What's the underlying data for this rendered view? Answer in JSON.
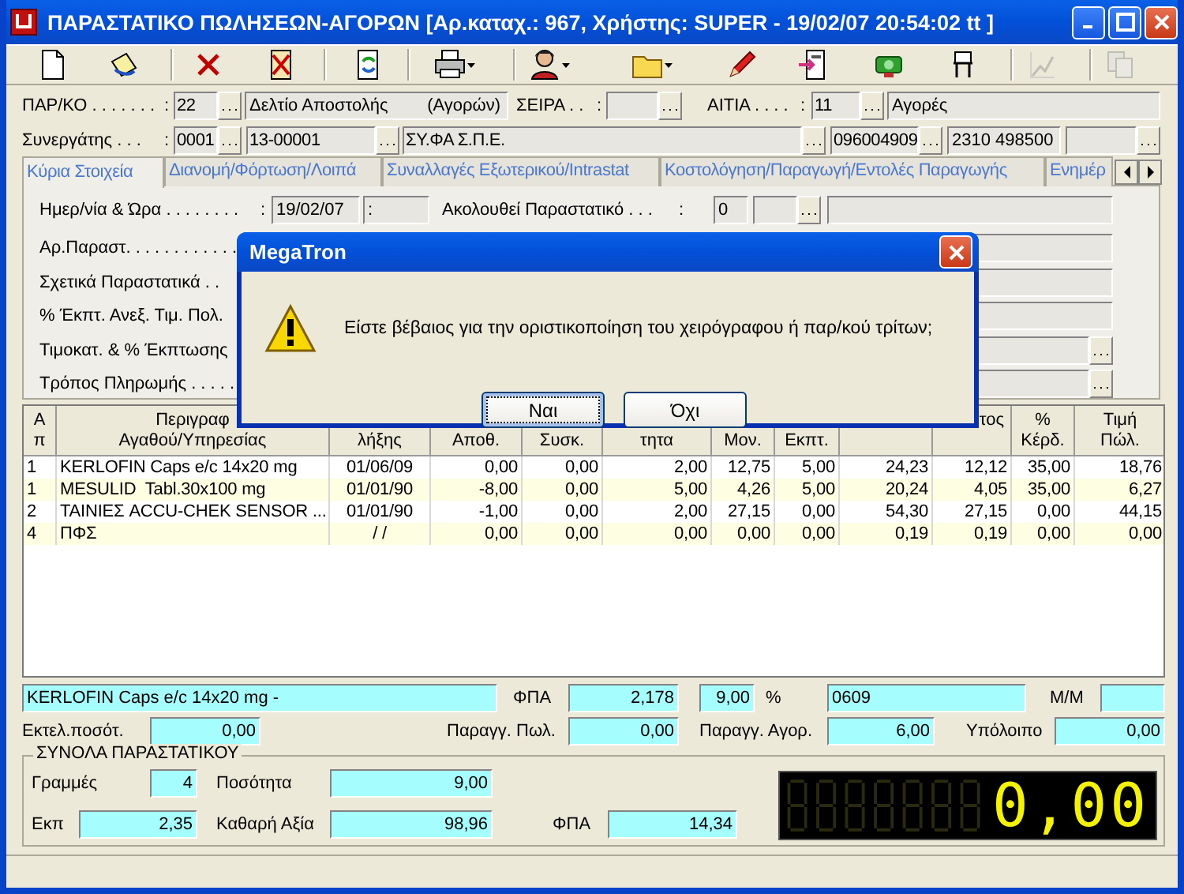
{
  "window": {
    "title": "ΠΑΡΑΣΤΑΤΙΚΟ ΠΩΛΗΣΕΩΝ-ΑΓΟΡΩΝ [Αρ.καταχ.: 967, Χρήστης: SUPER - 19/02/07 20:54:02 tt ]"
  },
  "toolbar": [
    {
      "kind": "new",
      "dropdown": false,
      "disabled": false
    },
    {
      "kind": "bucket",
      "dropdown": false,
      "disabled": false
    },
    {
      "kind": "delete",
      "dropdown": false,
      "disabled": false
    },
    {
      "kind": "cancel",
      "dropdown": false,
      "disabled": false
    },
    {
      "kind": "refresh",
      "dropdown": false,
      "disabled": false
    },
    {
      "kind": "print",
      "dropdown": true,
      "disabled": false
    },
    {
      "kind": "person",
      "dropdown": true,
      "disabled": false
    },
    {
      "kind": "folder",
      "dropdown": true,
      "disabled": false
    },
    {
      "kind": "pencil",
      "dropdown": false,
      "disabled": false
    },
    {
      "kind": "export",
      "dropdown": false,
      "disabled": false
    },
    {
      "kind": "cash",
      "dropdown": false,
      "disabled": false
    },
    {
      "kind": "chair",
      "dropdown": false,
      "disabled": false
    },
    {
      "kind": "chart",
      "dropdown": false,
      "disabled": true
    },
    {
      "kind": "copy",
      "dropdown": false,
      "disabled": true
    }
  ],
  "header_rows": [
    {
      "items": [
        {
          "kind": "label",
          "text": "ΠΑΡ/ΚΟ . . . . . . ."
        },
        {
          "kind": "colon",
          "text": ":"
        },
        {
          "kind": "lookup",
          "value": "22"
        },
        {
          "kind": "field",
          "value": "Δελτίο Αποστολής",
          "note": "(Αγορών)"
        },
        {
          "kind": "label",
          "text": "ΣΕΙΡΑ . ."
        },
        {
          "kind": "colon",
          "text": ":"
        },
        {
          "kind": "lookup"
        },
        {
          "kind": "label",
          "text": "ΑΙΤΙΑ . . . ."
        },
        {
          "kind": "colon",
          "text": ":"
        },
        {
          "kind": "lookup",
          "value": "11"
        },
        {
          "kind": "field",
          "value": "Αγορές"
        }
      ]
    },
    {
      "items": [
        {
          "kind": "label",
          "text": "Συνεργάτης . . ."
        },
        {
          "kind": "colon",
          "text": ":"
        },
        {
          "kind": "lookup",
          "value": "0001"
        },
        {
          "kind": "lookup",
          "value": "13-00001"
        },
        {
          "kind": "lookup",
          "value": "ΣΥ.ΦΑ Σ.Π.Ε."
        },
        {
          "kind": "lookup",
          "value": "096004909"
        },
        {
          "kind": "field",
          "value": "2310 498500"
        },
        {
          "kind": "lookup"
        }
      ]
    }
  ],
  "tabs": [
    {
      "label": "Κύρια Στοιχεία",
      "selected": true
    },
    {
      "label": "Διανομή/Φόρτωση/Λοιπά",
      "selected": false
    },
    {
      "label": "Συναλλαγές Εξωτερικού/Intrastat",
      "selected": false
    },
    {
      "label": "Κοστολόγηση/Παραγωγή/Εντολές Παραγωγής",
      "selected": false
    },
    {
      "label": "Ενημέρ",
      "selected": false
    }
  ],
  "main_tab": {
    "rows": [
      {
        "items": [
          {
            "kind": "label",
            "text": "Ημερ/νία & Ώρα . . . . . . . ."
          },
          {
            "kind": "colon",
            "text": ":"
          },
          {
            "kind": "field",
            "value": "19/02/07"
          },
          {
            "kind": "field",
            "value": ":"
          },
          {
            "kind": "label",
            "text": "Ακολουθεί Παραστατικό . . ."
          },
          {
            "kind": "colon",
            "text": ":"
          },
          {
            "kind": "field",
            "value": "0"
          },
          {
            "kind": "lookup"
          },
          {
            "kind": "field"
          }
        ]
      },
      {
        "items": [
          {
            "kind": "label",
            "text": "Αρ.Παραστ. . . . . . . . . . . ."
          },
          {
            "kind": "field"
          }
        ]
      },
      {
        "items": [
          {
            "kind": "label",
            "text": "Σχετικά Παραστατικά . ."
          },
          {
            "kind": "field"
          }
        ]
      },
      {
        "items": [
          {
            "kind": "label",
            "text": "% Έκπτ. Ανεξ. Τιμ. Πολ."
          },
          {
            "kind": "field"
          }
        ]
      },
      {
        "items": [
          {
            "kind": "label",
            "text": "Τιμοκατ. & % Έκπτωσης"
          },
          {
            "kind": "lookup"
          }
        ]
      },
      {
        "items": [
          {
            "kind": "label",
            "text": "Τρόπος Πληρωμής . . . . ."
          },
          {
            "kind": "lookup"
          }
        ]
      }
    ]
  },
  "table": {
    "columns": [
      {
        "top": "Α",
        "bottom": "π"
      },
      {
        "top": "Περιγραφ",
        "bottom": "Αγαθού/Υπηρεσίας"
      },
      {
        "bottom": "λήξης"
      },
      {
        "bottom": "Αποθ."
      },
      {
        "bottom": "Συσκ."
      },
      {
        "bottom": "τητα"
      },
      {
        "bottom": "Μον."
      },
      {
        "bottom": "Εκπτ."
      },
      {},
      {
        "top": "τος"
      },
      {
        "top": "%",
        "bottom": "Κέρδ."
      },
      {
        "top": "Τιμή",
        "bottom": "Πώλ."
      }
    ],
    "rows": [
      [
        "1",
        "KERLOFIN Caps e/c 14x20 mg",
        "01/06/09",
        "0,00",
        "0,00",
        "2,00",
        "12,75",
        "5,00",
        "24,23",
        "12,12",
        "35,00",
        "18,76"
      ],
      [
        "1",
        "MESULID  Tabl.30x100 mg",
        "01/01/90",
        "-8,00",
        "0,00",
        "5,00",
        "4,26",
        "5,00",
        "20,24",
        "4,05",
        "35,00",
        "6,27"
      ],
      [
        "2",
        "ΤΑΙΝΙΕΣ ACCU-CHEK SENSOR ...",
        "01/01/90",
        "-1,00",
        "0,00",
        "2,00",
        "27,15",
        "0,00",
        "54,30",
        "27,15",
        "0,00",
        "44,15"
      ],
      [
        "4",
        "ΠΦΣ",
        "/ /",
        "0,00",
        "0,00",
        "0,00",
        "0,00",
        "0,00",
        "0,19",
        "0,19",
        "0,00",
        "0,00"
      ]
    ]
  },
  "detail_rows": [
    {
      "items": [
        {
          "kind": "entry",
          "value": "KERLOFIN Caps e/c 14x20 mg -"
        },
        {
          "kind": "label",
          "text": "ΦΠΑ"
        },
        {
          "kind": "entry",
          "value": "2,178"
        },
        {
          "kind": "entry",
          "value": "9,00"
        },
        {
          "kind": "label",
          "text": "%"
        },
        {
          "kind": "entry",
          "value": "0609"
        },
        {
          "kind": "label",
          "text": "Μ/Μ"
        },
        {
          "kind": "entry"
        }
      ]
    },
    {
      "items": [
        {
          "kind": "label",
          "text": "Εκτελ.ποσότ."
        },
        {
          "kind": "entry",
          "value": "0,00"
        },
        {
          "kind": "label",
          "text": "Παραγγ. Πωλ."
        },
        {
          "kind": "entry",
          "value": "0,00"
        },
        {
          "kind": "label",
          "text": "Παραγγ. Αγορ."
        },
        {
          "kind": "entry",
          "value": "6,00"
        },
        {
          "kind": "label",
          "text": "Υπόλοιπο"
        },
        {
          "kind": "entry",
          "value": "0,00"
        }
      ]
    }
  ],
  "totals": {
    "title": "ΣΥΝΟΛΑ ΠΑΡΑΣΤΑΤΙΚΟΥ",
    "rows": [
      {
        "items": [
          {
            "kind": "label",
            "text": "Γραμμές"
          },
          {
            "kind": "entry",
            "value": "4"
          },
          {
            "kind": "label",
            "text": "Ποσότητα"
          },
          {
            "kind": "entry",
            "value": "9,00"
          }
        ]
      },
      {
        "items": [
          {
            "kind": "label",
            "text": "Εκπ"
          },
          {
            "kind": "entry",
            "value": "2,35"
          },
          {
            "kind": "label",
            "text": "Καθαρή Αξία"
          },
          {
            "kind": "entry",
            "value": "98,96"
          },
          {
            "kind": "label",
            "text": "ΦΠΑ"
          },
          {
            "kind": "entry",
            "value": "14,34"
          }
        ]
      }
    ],
    "display": "0,00"
  },
  "dialog": {
    "title": "MegaTron",
    "message": "Είστε βέβαιος για την οριστικοποίηση του χειρόγραφου ή παρ/κού τρίτων;",
    "buttons": [
      {
        "label": "Ναι",
        "focused": true
      },
      {
        "label": "Όχι",
        "focused": false
      }
    ]
  }
}
